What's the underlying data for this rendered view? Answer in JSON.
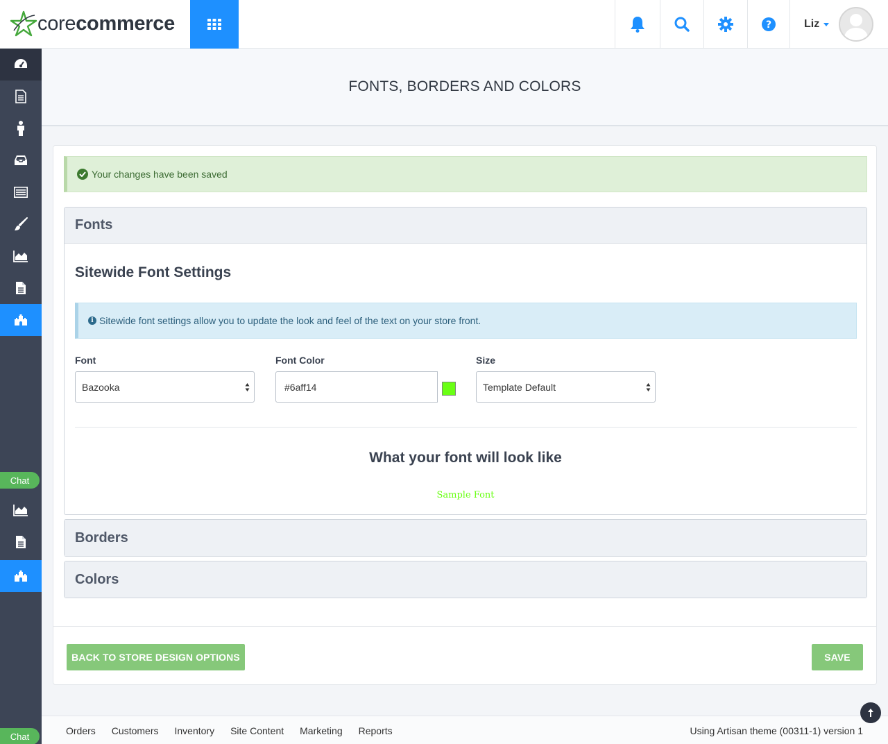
{
  "brand": {
    "name_light": "core",
    "name_bold": "commerce"
  },
  "header": {
    "user_name": "Liz",
    "icons": [
      "bell-icon",
      "search-icon",
      "gear-icon",
      "help-icon"
    ]
  },
  "sidebar": {
    "chat_label": "Chat",
    "chat_label_bottom": "Chat",
    "icons": [
      "dashboard-icon",
      "document-icon",
      "customer-icon",
      "inventory-icon",
      "list-icon",
      "brush-icon",
      "chart-icon",
      "file-icon",
      "castle-icon",
      "chart-icon",
      "file-icon",
      "castle-icon"
    ]
  },
  "page": {
    "title": "FONTS, BORDERS AND COLORS"
  },
  "alert": {
    "success_text": "Your changes have been saved"
  },
  "panels": {
    "fonts": {
      "title": "Fonts",
      "section_title": "Sitewide Font Settings",
      "info_text": "Sitewide font settings allow you to update the look and feel of the text on your store front.",
      "font_label": "Font",
      "font_value": "Bazooka",
      "color_label": "Font Color",
      "color_value": "#6aff14",
      "size_label": "Size",
      "size_value": "Template Default",
      "preview_title": "What your font will look like",
      "sample_text": "Sample Font"
    },
    "borders": {
      "title": "Borders"
    },
    "colors": {
      "title": "Colors"
    }
  },
  "buttons": {
    "back": "BACK TO STORE DESIGN OPTIONS",
    "save": "SAVE"
  },
  "footer": {
    "links": [
      "Orders",
      "Customers",
      "Inventory",
      "Site Content",
      "Marketing",
      "Reports"
    ],
    "theme_text": "Using Artisan theme (00311-1) version 1"
  },
  "colors": {
    "accent": "#1e90ff",
    "sidebar": "#3d4556",
    "success_button": "#86c87a",
    "sample_font": "#6aff14"
  }
}
